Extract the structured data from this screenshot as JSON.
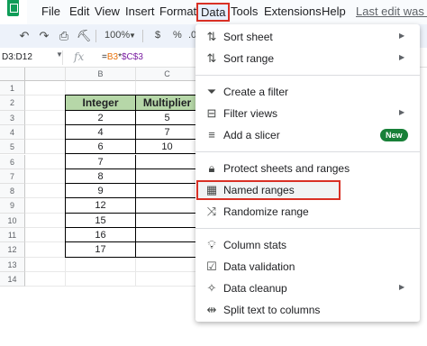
{
  "menubar": {
    "items": [
      "File",
      "Edit",
      "View",
      "Insert",
      "Format",
      "Data",
      "Tools",
      "Extensions",
      "Help"
    ],
    "last_edit": "Last edit was se"
  },
  "toolbar": {
    "zoom": "100%",
    "currency": "$",
    "percent": "%",
    "decimal_decrease": ".0"
  },
  "formula_bar": {
    "name_box": "D3:D12",
    "fx": "fx",
    "formula_eq": "=",
    "formula_ref1": "B3",
    "formula_op": "*",
    "formula_ref2": "$C$3"
  },
  "grid": {
    "columns": [
      "B",
      "C"
    ],
    "rows": [
      "1",
      "2",
      "3",
      "4",
      "5",
      "6",
      "7",
      "8",
      "9",
      "10",
      "11",
      "12",
      "13",
      "14"
    ],
    "headers": [
      "Integer",
      "Multiplier"
    ],
    "integer_values": [
      "2",
      "4",
      "6",
      "7",
      "8",
      "9",
      "12",
      "15",
      "16",
      "17"
    ],
    "multiplier_values": [
      "5",
      "7",
      "10",
      "",
      "",
      "",
      "",
      "",
      "",
      ""
    ]
  },
  "data_menu": {
    "sort_sheet": "Sort sheet",
    "sort_range": "Sort range",
    "create_filter": "Create a filter",
    "filter_views": "Filter views",
    "add_slicer": "Add a slicer",
    "new_badge": "New",
    "protect": "Protect sheets and ranges",
    "named_ranges": "Named ranges",
    "randomize": "Randomize range",
    "column_stats": "Column stats",
    "data_validation": "Data validation",
    "data_cleanup": "Data cleanup",
    "split_text": "Split text to columns"
  },
  "colors": {
    "highlight_border": "#d93025",
    "header_fill": "#b6d7a8",
    "new_badge": "#188038"
  }
}
